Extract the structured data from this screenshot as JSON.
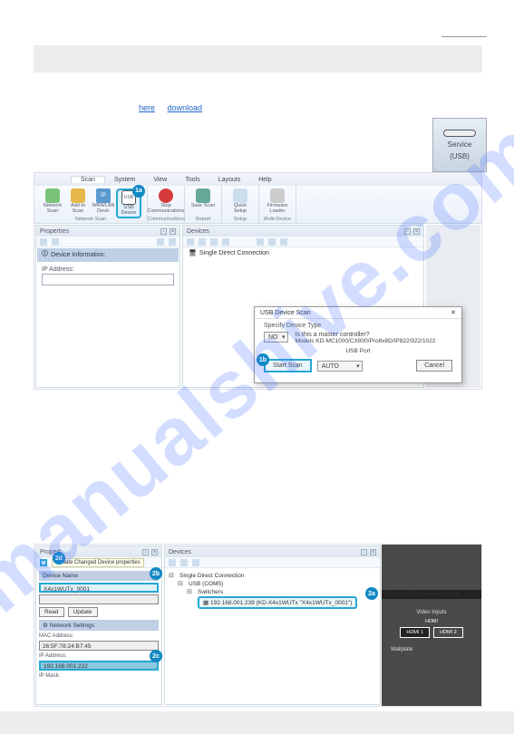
{
  "watermark": "manualshive.com",
  "links": {
    "a": "here",
    "b": "download"
  },
  "service_port": {
    "label": "Service",
    "sub": "(USB)"
  },
  "ribbon": {
    "tabs": [
      "Scan",
      "System",
      "View",
      "Tools",
      "Layouts",
      "Help"
    ],
    "groups": {
      "scan": {
        "items": [
          {
            "label": "Network Scan",
            "color": "#7ac27a"
          },
          {
            "label": "Add to Scan",
            "color": "#e6b84a"
          },
          {
            "label": "WAN/LAN Devic",
            "color": "#5a9acf"
          },
          {
            "label": "USB Device",
            "color": "#333",
            "box": "USB"
          }
        ],
        "caption": "Network Scan"
      },
      "comm": {
        "items": [
          {
            "label": "Stop Communications",
            "color": "#d73a3a"
          }
        ],
        "caption": "Communications"
      },
      "report": {
        "items": [
          {
            "label": "Save Scan",
            "color": "#6a9"
          }
        ],
        "caption": "Report"
      },
      "setup": {
        "items": [
          {
            "label": "Quick Setup",
            "color": "#aab"
          }
        ],
        "caption": "Setup"
      },
      "multi": {
        "items": [
          {
            "label": "Firmware Loader",
            "color": "#bbb"
          }
        ],
        "caption": "Multi-Device"
      }
    }
  },
  "badges": {
    "b1a": "1a",
    "b1b": "1b",
    "b2a": "2a",
    "b2b": "2b",
    "b2c": "2c",
    "b2d": "2d"
  },
  "properties": {
    "title": "Properties",
    "info_header": "Device Information:",
    "ip_label": "IP Address:"
  },
  "devices": {
    "title": "Devices",
    "row": "Single Direct Connection"
  },
  "dialog": {
    "title": "USB Device Scan",
    "sub": "Specify Device Type",
    "question": "Is this a master controller?",
    "models": "Models KD-MC1000/CX800/Pro8x8D/IP822/922/1022",
    "no": "NO",
    "usb_port": "USB Port",
    "auto": "AUTO",
    "start": "Start Scan",
    "cancel": "Cancel"
  },
  "shot2": {
    "prop_title": "Propert",
    "update_tip": "Update Changed Device properties",
    "device_name_h": "Device Name",
    "device_name_v": "X4x1WUTx_0001",
    "read": "Read",
    "update": "Update",
    "net_h": "Network Settings",
    "mac_l": "MAC Address:",
    "mac_v": "26:5F:78:24:B7:45",
    "ipaddr_l": "IP Address:",
    "ipaddr_v": "192.168.001.222",
    "ipmask_l": "IP Mask:",
    "dev_title": "Devices",
    "tree_root": "Single Direct Connection",
    "tree_usb": "USB (COM5)",
    "tree_sw": "Switchers",
    "tree_leaf": "192.168.001.239 (KD-X4x1WUTx \"X4x1WUTx_0001\")",
    "ctrl_title": "KD-X4x1WUTx Presentation Swit",
    "video_inputs": "Video Inputs",
    "hdmi_label": "HDMI",
    "hdmi1": "HDMI 1",
    "hdmi2": "HDMI 2",
    "wallplate": "Wallplate"
  }
}
